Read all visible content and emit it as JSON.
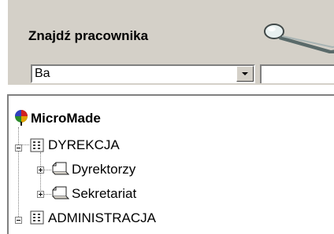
{
  "search": {
    "title": "Znajdź pracownika",
    "combo_value": "Ba",
    "second_field_value": ""
  },
  "tree": {
    "root": {
      "label": "MicroMade",
      "icon": "company-logo-icon"
    },
    "nodes": [
      {
        "label": "DYREKCJA",
        "icon": "org-unit-icon",
        "expanded": true
      },
      {
        "label": "Dyrektorzy",
        "icon": "folder-icon",
        "expanded": false
      },
      {
        "label": "Sekretariat",
        "icon": "folder-icon",
        "expanded": false
      },
      {
        "label": "ADMINISTRACJA",
        "icon": "org-unit-icon",
        "expanded": true
      }
    ]
  }
}
